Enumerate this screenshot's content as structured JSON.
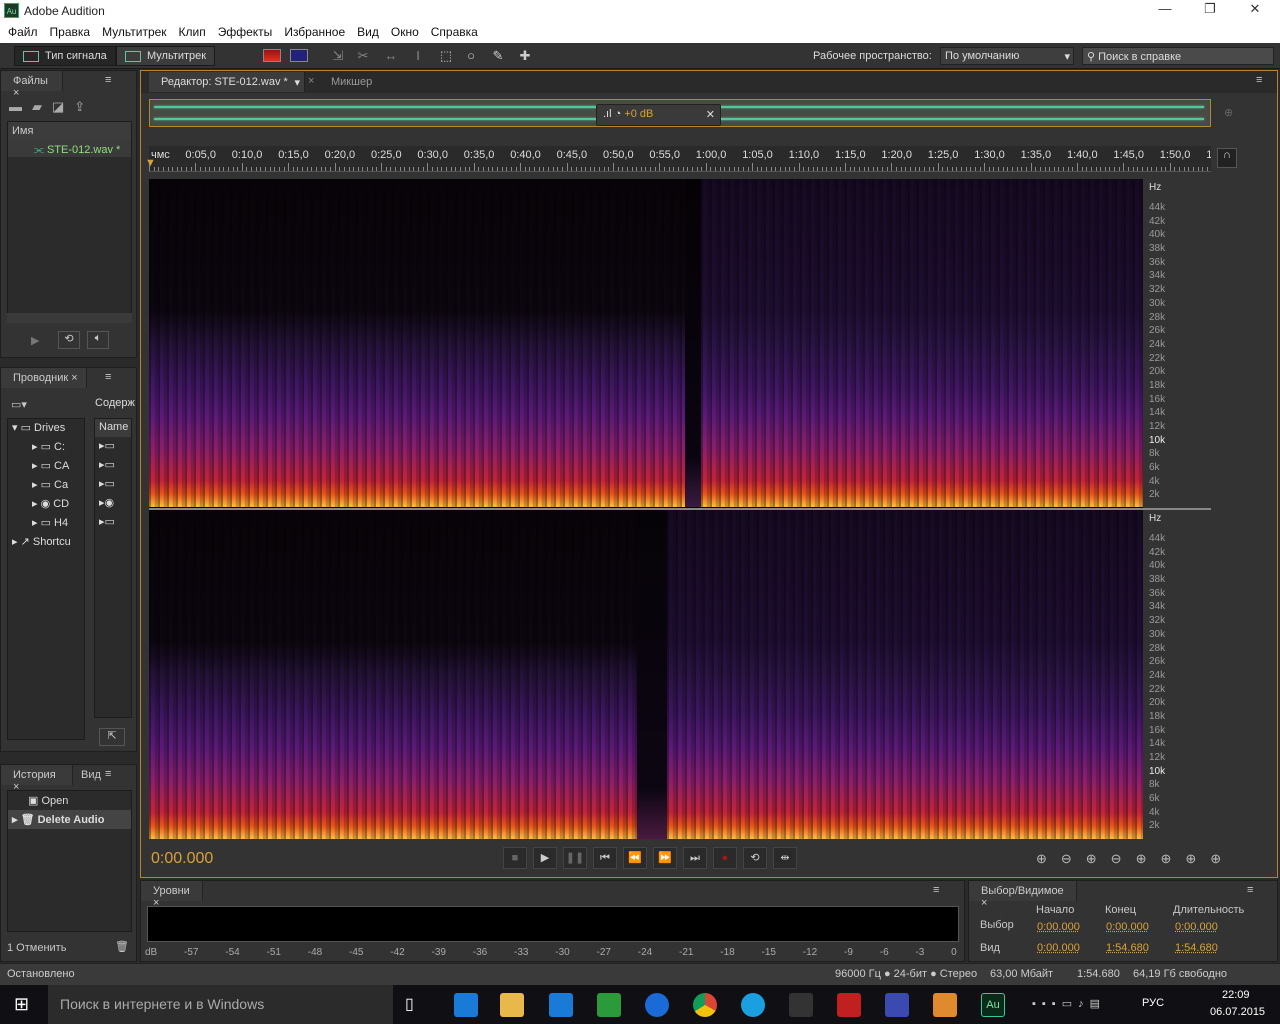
{
  "window": {
    "title": "Adobe Audition",
    "logo": "Au",
    "controls": [
      "—",
      "❐",
      "✕"
    ]
  },
  "menu": [
    "Файл",
    "Правка",
    "Мультитрек",
    "Клип",
    "Эффекты",
    "Избранное",
    "Вид",
    "Окно",
    "Справка"
  ],
  "toolbar": {
    "waveform_label": "Тип сигнала",
    "multitrack_label": "Мультитрек",
    "workspace_label": "Рабочее пространство:",
    "workspace_value": "По умолчанию",
    "search_placeholder": "Поиск в справке"
  },
  "files_panel": {
    "tab": "Файлы",
    "column": "Имя",
    "items": [
      "STE-012.wav *"
    ]
  },
  "explorer_panel": {
    "tab": "Проводник",
    "contents_label": "Содерж",
    "tree": [
      "Drives",
      "C:",
      "CA",
      "Ca",
      "CD",
      "H4",
      "Shortcu"
    ],
    "column": "Name"
  },
  "history_panel": {
    "tabs": [
      "История",
      "Вид"
    ],
    "items": [
      "Open",
      "Delete Audio"
    ],
    "undo_label": "1 Отменить"
  },
  "editor": {
    "tabs": [
      "Редактор: STE-012.wav *",
      "Микшер"
    ],
    "gain": "+0 dB",
    "ruler": [
      "чмс",
      "0:05,0",
      "0:10,0",
      "0:15,0",
      "0:20,0",
      "0:25,0",
      "0:30,0",
      "0:35,0",
      "0:40,0",
      "0:45,0",
      "0:50,0",
      "0:55,0",
      "1:00,0",
      "1:05,0",
      "1:10,0",
      "1:15,0",
      "1:20,0",
      "1:25,0",
      "1:30,0",
      "1:35,0",
      "1:40,0",
      "1:45,0",
      "1:50,0",
      "1:5"
    ],
    "hz_unit": "Hz",
    "hz_ticks": [
      "44k",
      "42k",
      "40k",
      "38k",
      "36k",
      "34k",
      "32k",
      "30k",
      "28k",
      "26k",
      "24k",
      "22k",
      "20k",
      "18k",
      "16k",
      "14k",
      "12k",
      "10k",
      "8k",
      "6k",
      "4k",
      "2k"
    ],
    "time": "0:00.000"
  },
  "levels": {
    "tab": "Уровни",
    "scale": [
      "dB",
      "-57",
      "-54",
      "-51",
      "-48",
      "-45",
      "-42",
      "-39",
      "-36",
      "-33",
      "-30",
      "-27",
      "-24",
      "-21",
      "-18",
      "-15",
      "-12",
      "-9",
      "-6",
      "-3",
      "0"
    ]
  },
  "selection": {
    "tab": "Выбор/Видимое",
    "headers": [
      "Начало",
      "Конец",
      "Длительность"
    ],
    "rows": [
      {
        "label": "Выбор",
        "values": [
          "0:00.000",
          "0:00.000",
          "0:00.000"
        ]
      },
      {
        "label": "Вид",
        "values": [
          "0:00.000",
          "1:54.680",
          "1:54.680"
        ]
      }
    ]
  },
  "status": {
    "state": "Остановлено",
    "format": "96000 Гц ● 24-бит ● Стерео",
    "size": "63,00 Мбайт",
    "duration": "1:54.680",
    "free": "64,19 Гб свободно"
  },
  "taskbar": {
    "search": "Поиск в интернете и в Windows",
    "lang": "РУС",
    "time": "22:09",
    "date": "06.07.2015"
  },
  "colors": {
    "accent": "#d9a13a",
    "waveform": "#4fc89a",
    "spectrogram_hot": "#ffc040"
  }
}
